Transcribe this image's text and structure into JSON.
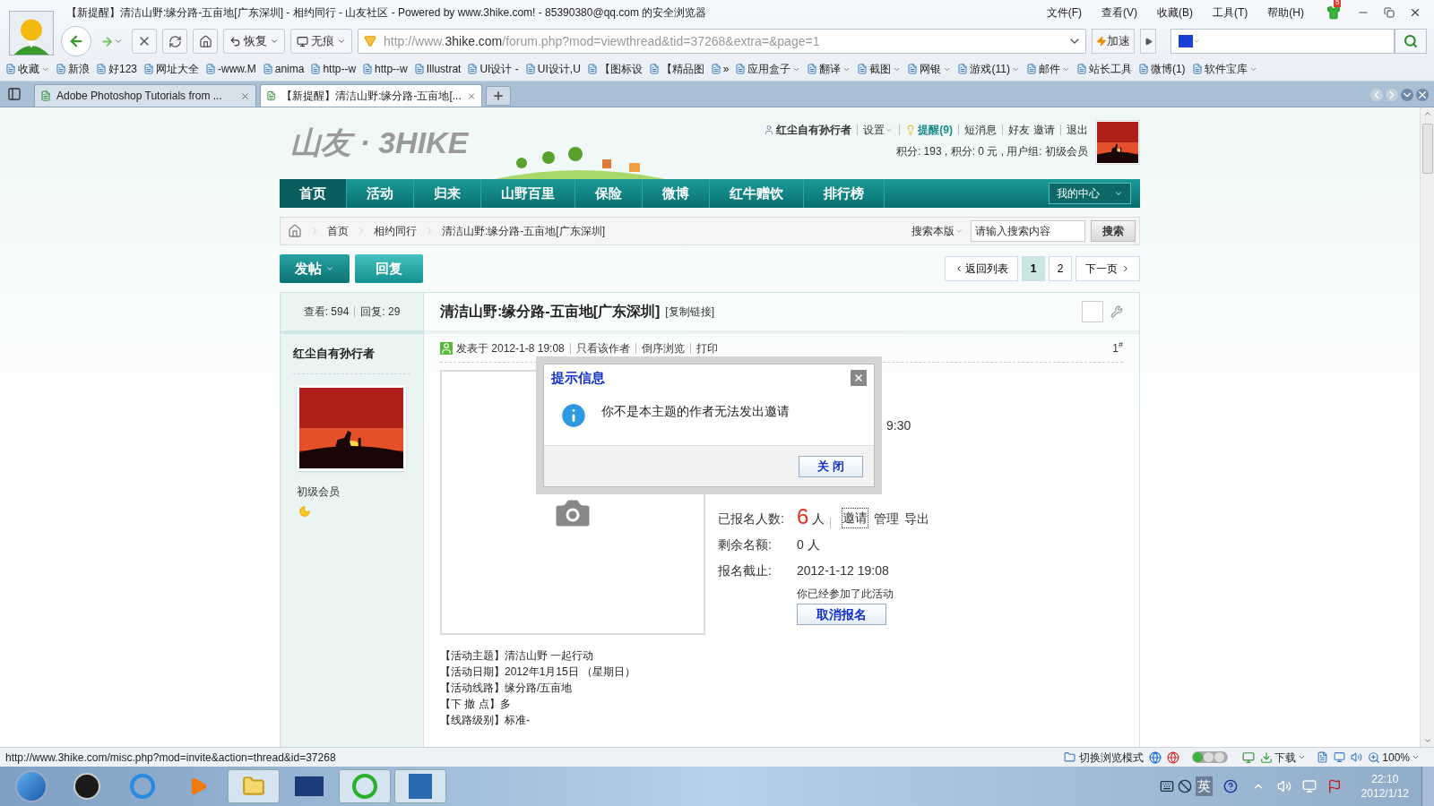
{
  "browser": {
    "window_title": "【新提醒】清洁山野:缘分路-五亩地[广东深圳] - 相约同行 - 山友社区 - Powered by www.3hike.com! - 85390380@qq.com 的安全浏览器",
    "menu": [
      "文件(F)",
      "查看(V)",
      "收藏(B)",
      "工具(T)",
      "帮助(H)"
    ],
    "notification_badge": "5",
    "toolbar": {
      "restore": "恢复",
      "incognito": "无痕",
      "url_scheme": "http://www.",
      "url_domain": "3hike.com",
      "url_path": "/forum.php?mod=viewthread&tid=37268&extra=&page=1",
      "accelerate": "加速"
    },
    "bookmarks": [
      {
        "label": "收藏",
        "dropdown": true
      },
      {
        "label": "新浪",
        "dropdown": false
      },
      {
        "label": "好123",
        "dropdown": false
      },
      {
        "label": "网址大全",
        "dropdown": false
      },
      {
        "label": "-www.M",
        "dropdown": false
      },
      {
        "label": "anima",
        "dropdown": false
      },
      {
        "label": "http--w",
        "dropdown": false
      },
      {
        "label": "http--w",
        "dropdown": false
      },
      {
        "label": "Illustrat",
        "dropdown": false
      },
      {
        "label": "UI设计 -",
        "dropdown": false
      },
      {
        "label": "UI设计,U",
        "dropdown": false
      },
      {
        "label": "【图标设",
        "dropdown": false
      },
      {
        "label": "【精品图",
        "dropdown": false
      },
      {
        "label": "»",
        "dropdown": false
      },
      {
        "label": "应用盒子",
        "dropdown": true
      },
      {
        "label": "翻译",
        "dropdown": true
      },
      {
        "label": "截图",
        "dropdown": true
      },
      {
        "label": "网银",
        "dropdown": true
      },
      {
        "label": "游戏(11)",
        "dropdown": true
      },
      {
        "label": "邮件",
        "dropdown": true
      },
      {
        "label": "站长工具",
        "dropdown": false
      },
      {
        "label": "微博(1)",
        "dropdown": false
      },
      {
        "label": "软件宝库",
        "dropdown": true
      }
    ],
    "tabs": [
      {
        "title": "Adobe Photoshop Tutorials from ...",
        "selected": false
      },
      {
        "title": "【新提醒】清洁山野:缘分路-五亩地[...",
        "selected": true
      }
    ]
  },
  "forum": {
    "logo": "山友 · 3HIKE",
    "user": {
      "name": "红尘自有孙行者",
      "settings": "设置",
      "reminders": "提醒(9)",
      "messages": "短消息",
      "friends": "好友",
      "invite": "邀请",
      "logout": "退出",
      "stats": "积分: 193 , 积分: 0 元 , 用户组: 初级会员"
    },
    "nav": [
      {
        "label": "首页",
        "selected": true
      },
      {
        "label": "活动",
        "selected": false
      },
      {
        "label": "归来",
        "selected": false
      },
      {
        "label": "山野百里",
        "selected": false
      },
      {
        "label": "保险",
        "selected": false
      },
      {
        "label": "微博",
        "selected": false
      },
      {
        "label": "红牛赠饮",
        "selected": false
      },
      {
        "label": "排行榜",
        "selected": false
      }
    ],
    "my_center": "我的中心",
    "breadcrumb": [
      "首页",
      "相约同行",
      "清洁山野:缘分路-五亩地[广东深圳]"
    ],
    "search": {
      "scope": "搜索本版",
      "placeholder": "请输入搜索内容",
      "button": "搜索"
    },
    "actions": {
      "post": "发帖",
      "reply": "回复"
    },
    "pager": {
      "back": "返回列表",
      "pages": [
        {
          "label": "1",
          "selected": true
        },
        {
          "label": "2",
          "selected": false
        }
      ],
      "next": "下一页"
    },
    "thread": {
      "views": "查看: 594",
      "replies": "回复: 29",
      "title": "清洁山野:缘分路-五亩地[广东深圳]",
      "copy_link": "[复制链接]",
      "checked": false,
      "author": "红尘自有孙行者",
      "rank": "初级会员",
      "meta": [
        "发表于 2012-1-8 19:08",
        "只看该作者",
        "倒序浏览",
        "打印"
      ],
      "floor": "1$^{#}$",
      "time_fragment": "9:30",
      "signup_label": "已报名人数:",
      "signup_count": "6",
      "signup_unit": "人",
      "signup_actions": [
        "邀请",
        "管理",
        "导出"
      ],
      "fields": [
        {
          "label": "剩余名额:",
          "value": "0 人"
        },
        {
          "label": "报名截止:",
          "value": "2012-1-12 19:08"
        }
      ],
      "joined_note": "你已经参加了此活动",
      "cancel_button": "取消报名",
      "body": [
        "【活动主题】清洁山野 一起行动",
        "【活动日期】2012年1月15日 （星期日）",
        "【活动线路】缘分路/五亩地",
        "【下 撤 点】多",
        "【线路级别】标准-"
      ]
    }
  },
  "dialog": {
    "title": "提示信息",
    "message": "你不是本主题的作者无法发出邀请",
    "button": "关 闭"
  },
  "status_bar": {
    "url": "http://www.3hike.com/misc.php?mod=invite&action=thread&id=37268",
    "switch_mode": "切换浏览模式",
    "download": "下载",
    "zoom": "100%"
  },
  "taskbar": {
    "ime": "英",
    "time": "22:10",
    "date": "2012/1/12"
  }
}
